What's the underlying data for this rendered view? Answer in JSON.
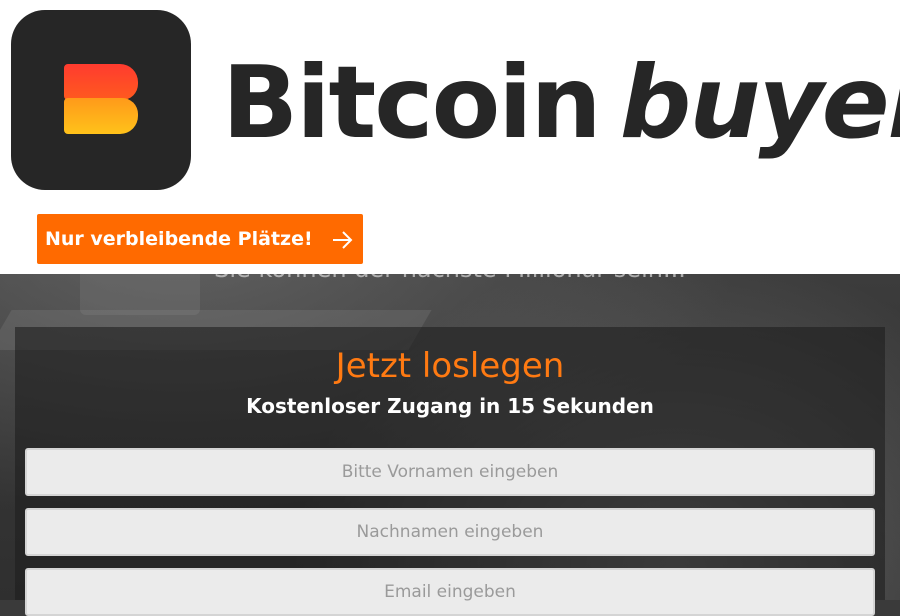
{
  "brand": {
    "name_main": "Bitcoin",
    "name_accent": "buyer"
  },
  "cta": {
    "label": "Nur verbleibende Plätze!",
    "arrow_icon": "arrow-right-icon"
  },
  "hero": {
    "subline": "Sie können der nächste Millionär sein..."
  },
  "form": {
    "title": "Jetzt loslegen",
    "subtitle": "Kostenloser Zugang in 15 Sekunden",
    "first_name_placeholder": "Bitte Vornamen eingeben",
    "last_name_placeholder": "Nachnamen eingeben",
    "email_placeholder": "Email eingeben"
  },
  "colors": {
    "accent": "#ff6a00",
    "logo_dark": "#262626"
  }
}
